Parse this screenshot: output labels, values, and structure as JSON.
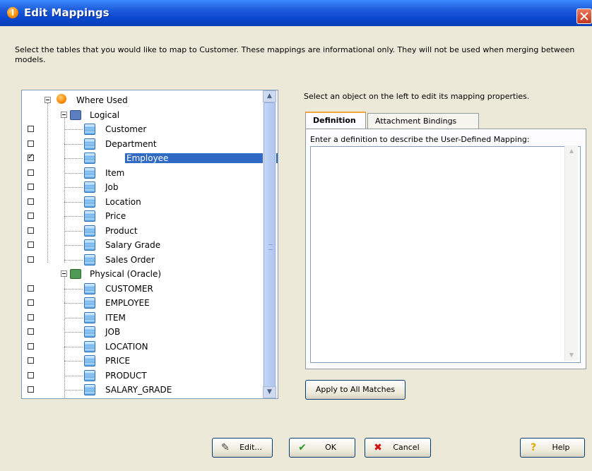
{
  "window": {
    "title": "Edit Mappings"
  },
  "instructions": "Select the tables that you would like to map to Customer. These mappings are informational only. They will not be used when merging between models.",
  "tree": {
    "root": "Where Used",
    "logical": {
      "label": "Logical",
      "items": [
        {
          "label": "Customer",
          "checked": false
        },
        {
          "label": "Department",
          "checked": false
        },
        {
          "label": "Employee",
          "checked": true,
          "selected": true
        },
        {
          "label": "Item",
          "checked": false
        },
        {
          "label": "Job",
          "checked": false
        },
        {
          "label": "Location",
          "checked": false
        },
        {
          "label": "Price",
          "checked": false
        },
        {
          "label": "Product",
          "checked": false
        },
        {
          "label": "Salary Grade",
          "checked": false
        },
        {
          "label": "Sales Order",
          "checked": false
        }
      ]
    },
    "physical": {
      "label": "Physical (Oracle)",
      "items": [
        {
          "label": "CUSTOMER",
          "checked": false
        },
        {
          "label": "EMPLOYEE",
          "checked": false
        },
        {
          "label": "ITEM",
          "checked": false
        },
        {
          "label": "JOB",
          "checked": false
        },
        {
          "label": "LOCATION",
          "checked": false
        },
        {
          "label": "PRICE",
          "checked": false
        },
        {
          "label": "PRODUCT",
          "checked": false
        },
        {
          "label": "SALARY_GRADE",
          "checked": false
        }
      ]
    }
  },
  "right": {
    "hint": "Select an object on the left to edit its mapping properties.",
    "tabs": [
      "Definition",
      "Attachment Bindings"
    ],
    "active_tab": "Definition",
    "definition_label": "Enter a definition to describe the User-Defined Mapping:",
    "definition_value": "",
    "apply_button": "Apply to All Matches"
  },
  "buttons": {
    "edit": "Edit...",
    "ok": "OK",
    "cancel": "Cancel",
    "help": "Help"
  },
  "colors": {
    "selection": "#316ac5",
    "title_bar": "#0a46cf",
    "dialog_bg": "#ece9d8"
  }
}
